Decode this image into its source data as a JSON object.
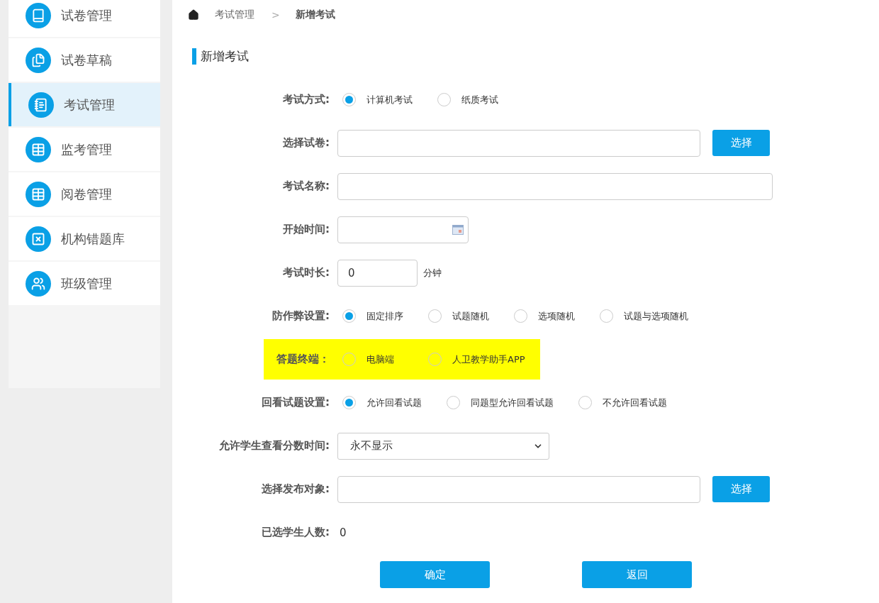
{
  "sidebar": {
    "items": [
      {
        "label": "试卷管理",
        "selected": false
      },
      {
        "label": "试卷草稿",
        "selected": false
      },
      {
        "label": "考试管理",
        "selected": true
      },
      {
        "label": "监考管理",
        "selected": false
      },
      {
        "label": "阅卷管理",
        "selected": false
      },
      {
        "label": "机构错题库",
        "selected": false
      },
      {
        "label": "班级管理",
        "selected": false
      }
    ]
  },
  "breadcrumb": {
    "parent": "考试管理",
    "separator": ">",
    "current": "新增考试"
  },
  "section_title": "新增考试",
  "form": {
    "rows": [
      {
        "kind": "radio",
        "label": "考试方式:",
        "highlighted": false,
        "options": [
          {
            "label": "计算机考试",
            "selected": true
          },
          {
            "label": "纸质考试",
            "selected": false
          }
        ]
      },
      {
        "kind": "picker",
        "label": "选择试卷:",
        "highlighted": false,
        "button": "选择"
      },
      {
        "kind": "text",
        "label": "考试名称:",
        "highlighted": false
      },
      {
        "kind": "date",
        "label": "开始时间:",
        "highlighted": false
      },
      {
        "kind": "number",
        "label": "考试时长:",
        "highlighted": false,
        "value": "0",
        "unit": "分钟"
      },
      {
        "kind": "radio",
        "label": "防作弊设置:",
        "highlighted": false,
        "options": [
          {
            "label": "固定排序",
            "selected": true
          },
          {
            "label": "试题随机",
            "selected": false
          },
          {
            "label": "选项随机",
            "selected": false
          },
          {
            "label": "试题与选项随机",
            "selected": false
          }
        ]
      },
      {
        "kind": "radio",
        "label": "答题终端：",
        "highlighted": true,
        "options": [
          {
            "label": "电脑端",
            "selected": false
          },
          {
            "label": "人卫教学助手APP",
            "selected": false
          }
        ]
      },
      {
        "kind": "radio",
        "label": "回看试题设置:",
        "highlighted": false,
        "options": [
          {
            "label": "允许回看试题",
            "selected": true
          },
          {
            "label": "同题型允许回看试题",
            "selected": false
          },
          {
            "label": "不允许回看试题",
            "selected": false
          }
        ]
      },
      {
        "kind": "select",
        "label": "允许学生查看分数时间:",
        "highlighted": false,
        "value": "永不显示"
      },
      {
        "kind": "picker",
        "label": "选择发布对象:",
        "highlighted": false,
        "button": "选择"
      },
      {
        "kind": "value",
        "label": "已选学生人数:",
        "highlighted": false,
        "value": "0"
      }
    ]
  },
  "actions": [
    {
      "label": "确定"
    },
    {
      "label": "返回"
    }
  ]
}
